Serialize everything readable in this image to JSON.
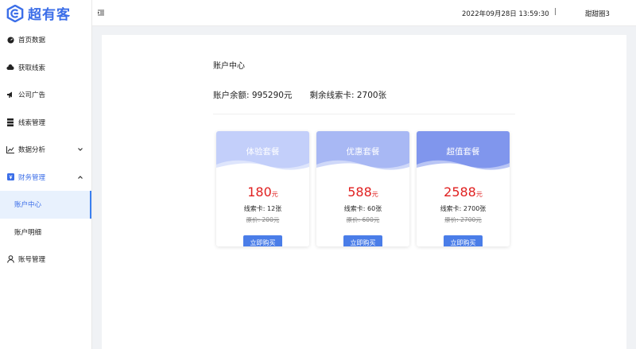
{
  "brand": {
    "name": "超有客",
    "color": "#3b6ee8"
  },
  "header": {
    "menu_icon": "menu-fold-icon",
    "datetime": "2022年09月28日 13:59:30",
    "separator": "|",
    "username": "甜甜圈3"
  },
  "sidebar": {
    "items": [
      {
        "label": "首页数据",
        "icon": "dashboard-icon"
      },
      {
        "label": "获取线索",
        "icon": "cloud-icon"
      },
      {
        "label": "公司广告",
        "icon": "megaphone-icon"
      },
      {
        "label": "线索管理",
        "icon": "list-icon"
      },
      {
        "label": "数据分析",
        "icon": "chart-icon",
        "expandable": true,
        "expanded": false
      },
      {
        "label": "财务管理",
        "icon": "wallet-icon",
        "expandable": true,
        "expanded": true
      },
      {
        "label": "账户中心",
        "sub": true,
        "active": true
      },
      {
        "label": "账户明细",
        "sub": true
      },
      {
        "label": "账号管理",
        "icon": "user-icon"
      }
    ]
  },
  "main": {
    "title": "账户中心",
    "balance": "账户余额: 995290元",
    "remaining": "剩余线索卡: 2700张"
  },
  "packages": [
    {
      "name": "体验套餐",
      "price": "180",
      "unit": "元",
      "count": "线索卡: 12张",
      "original": "原价: 200元",
      "button": "立即购买",
      "color": "#c3cffa"
    },
    {
      "name": "优惠套餐",
      "price": "588",
      "unit": "元",
      "count": "线索卡: 60张",
      "original": "原价: 600元",
      "button": "立即购买",
      "color": "#a8b8f4"
    },
    {
      "name": "超值套餐",
      "price": "2588",
      "unit": "元",
      "count": "线索卡: 2700张",
      "original": "原价: 2700元",
      "button": "立即购买",
      "color": "#8096ed"
    }
  ]
}
